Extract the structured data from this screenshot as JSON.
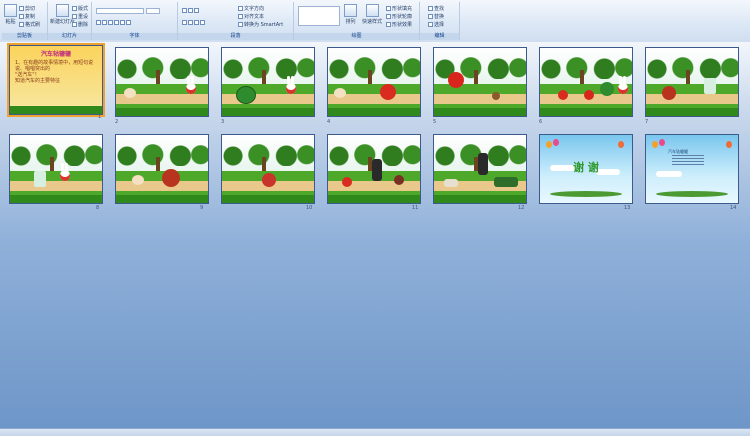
{
  "ribbon": {
    "groups": [
      "剪贴板",
      "幻灯片",
      "字体",
      "段落",
      "绘图",
      "编辑"
    ],
    "clipboard": {
      "paste": "粘贴",
      "cut": "剪切",
      "copy": "复制",
      "format": "格式刷"
    },
    "slides": {
      "new_slide": "新建幻灯片",
      "layout": "版式",
      "reset": "重设",
      "delete": "删除"
    },
    "paragraph": {
      "text_direction": "文字方向",
      "align_text": "对齐文本",
      "smartart": "转换为 SmartArt"
    },
    "drawing": {
      "arrange": "排列",
      "quick_styles": "快速样式",
      "fill": "形状填充",
      "outline": "形状轮廓",
      "effects": "形状效果"
    },
    "editing": {
      "find": "查找",
      "replace": "替换",
      "select": "选择"
    }
  },
  "slides": [
    {
      "num": "1",
      "title": "汽车轱辘辘",
      "lines": [
        "1、在有趣的故事情境中，用短句说说、唱唱突出的",
        "\"送汽车\"！",
        "知道汽车的主要特征"
      ]
    },
    {
      "num": "2"
    },
    {
      "num": "3"
    },
    {
      "num": "4"
    },
    {
      "num": "5"
    },
    {
      "num": "6"
    },
    {
      "num": "7"
    },
    {
      "num": "8"
    },
    {
      "num": "9"
    },
    {
      "num": "10"
    },
    {
      "num": "11"
    },
    {
      "num": "12"
    },
    {
      "num": "13",
      "title": "谢 谢"
    },
    {
      "num": "14",
      "title": "汽车轱辘辘"
    }
  ],
  "colors": {
    "accent": "#f0a22e",
    "ribbon": "#dbe7f5",
    "canvas": "#6e96c8"
  }
}
